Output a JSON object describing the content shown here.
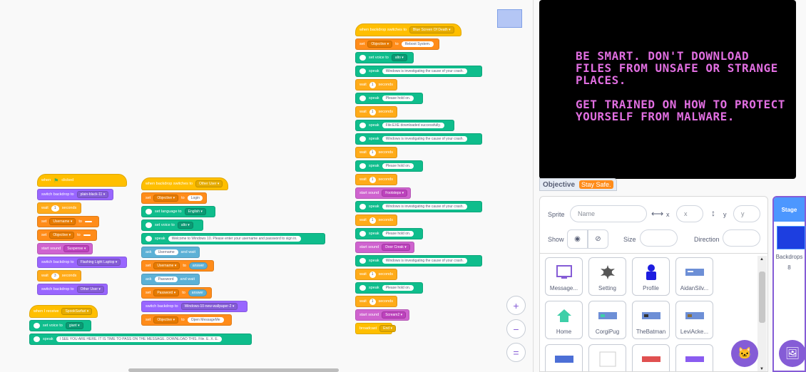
{
  "scripts": {
    "s1": {
      "hat": "when",
      "hat_suffix": "clicked",
      "b1": {
        "op": "switch backdrop to",
        "arg": "plain-black-11"
      },
      "b2": {
        "op": "wait",
        "arg": "1",
        "unit": "seconds"
      },
      "b3": {
        "op": "set",
        "arg": "Username",
        "to": "to",
        "val": ""
      },
      "b4": {
        "op": "set",
        "arg": "Objective",
        "to": "to",
        "val": ""
      },
      "b5": {
        "op": "start sound",
        "arg": "Suspense"
      },
      "b6": {
        "op": "switch backdrop to",
        "arg": "Flashing Light Laptop"
      },
      "b7": {
        "op": "wait",
        "arg": "3",
        "unit": "seconds"
      },
      "b8": {
        "op": "switch backdrop to",
        "arg": "Other User"
      }
    },
    "s2": {
      "hat": "when I receive",
      "hat_arg": "SpookSarfari",
      "b1": {
        "op": "set voice to",
        "arg": "giant"
      },
      "b2": {
        "op": "speak",
        "arg": "I SEE YOU ARE HERE. IT IS TIME TO PASS ON THE MESSAGE.  DOWNLOAD THIS.  File. E. X. E."
      }
    },
    "s3": {
      "hat": "when backdrop switches to",
      "hat_arg": "Other User",
      "b1": {
        "op": "set",
        "arg": "Objective",
        "to": "to",
        "val": "Login"
      },
      "b2": {
        "op": "set language to",
        "arg": "English"
      },
      "b3": {
        "op": "set voice to",
        "arg": "alto"
      },
      "b4": {
        "op": "speak",
        "arg": "Welcome to Windows 10. Please enter your username and password to sign in."
      },
      "b5": {
        "op": "ask",
        "arg": "Username",
        "suffix": "and wait"
      },
      "b6": {
        "op": "set",
        "arg": "Username",
        "to": "to",
        "val": "answer"
      },
      "b7": {
        "op": "ask",
        "arg": "Password",
        "suffix": "and wait"
      },
      "b8": {
        "op": "set",
        "arg": "Password",
        "to": "to",
        "val": "answer"
      },
      "b9": {
        "op": "switch backdrop to",
        "arg": "Windows-10-new-wallpaper-2"
      },
      "b10": {
        "op": "set",
        "arg": "Objective",
        "to": "to",
        "val": "Open MessageMe"
      }
    },
    "s4": {
      "hat": "when backdrop switches to",
      "hat_arg": "Blue Screen Of Death",
      "b1": {
        "op": "set",
        "arg": "Objective",
        "to": "to",
        "val": "Reboot System."
      },
      "b2": {
        "op": "set voice to",
        "arg": "alto"
      },
      "b3": {
        "op": "speak",
        "arg": "Windows is investigating the cause of your crash."
      },
      "b4": {
        "op": "wait",
        "arg": "1",
        "unit": "seconds"
      },
      "b5": {
        "op": "speak",
        "arg": "Please hold on."
      },
      "b6": {
        "op": "wait",
        "arg": "1",
        "unit": "seconds"
      },
      "b7": {
        "op": "speak",
        "arg": "File.EXE downloaded successfully."
      },
      "b8": {
        "op": "speak",
        "arg": "Windows is investigating the cause of your crash."
      },
      "b9": {
        "op": "wait",
        "arg": "1",
        "unit": "seconds"
      },
      "b10": {
        "op": "speak",
        "arg": "Please hold on."
      },
      "b11": {
        "op": "wait",
        "arg": "1",
        "unit": "seconds"
      },
      "b12": {
        "op": "start sound",
        "arg": "Footsteps"
      },
      "b13": {
        "op": "speak",
        "arg": "Windows is investigating the cause of your crash."
      },
      "b14": {
        "op": "wait",
        "arg": "1",
        "unit": "seconds"
      },
      "b15": {
        "op": "speak",
        "arg": "Please hold on."
      },
      "b16": {
        "op": "start sound",
        "arg": "Door Creak"
      },
      "b17": {
        "op": "speak",
        "arg": "Windows is investigating the cause of your crash."
      },
      "b18": {
        "op": "wait",
        "arg": "1",
        "unit": "seconds"
      },
      "b19": {
        "op": "speak",
        "arg": "Please hold on."
      },
      "b20": {
        "op": "wait",
        "arg": "1",
        "unit": "seconds"
      },
      "b21": {
        "op": "start sound",
        "arg": "Scream2"
      },
      "b22": {
        "op": "broadcast",
        "arg": "End"
      }
    }
  },
  "zoom": {
    "in": "+",
    "out": "−",
    "reset": "="
  },
  "stage": {
    "text": "BE SMART. DON'T DOWNLOAD\nFILES FROM UNSAFE OR STRANGE\nPLACES.\n\nGET TRAINED ON HOW TO PROTECT\nYOURSELF FROM MALWARE.",
    "text_color": "#e06ee0",
    "background": "#000000"
  },
  "monitor": {
    "label": "Objective",
    "value": "Stay Safe."
  },
  "sprite_info": {
    "sprite_label": "Sprite",
    "name_placeholder": "Name",
    "x_label": "x",
    "x_placeholder": "x",
    "y_label": "y",
    "y_placeholder": "y",
    "show_label": "Show",
    "size_label": "Size",
    "direction_label": "Direction"
  },
  "sprites": [
    {
      "name": "Message...",
      "icon": "monitor-icon"
    },
    {
      "name": "Setting",
      "icon": "gear-splat-icon"
    },
    {
      "name": "Profile",
      "icon": "person-icon"
    },
    {
      "name": "AidanSilv...",
      "icon": "screenshot-icon"
    },
    {
      "name": "Home",
      "icon": "house-icon"
    },
    {
      "name": "CorgiPug",
      "icon": "screenshot-icon"
    },
    {
      "name": "TheBatman",
      "icon": "screenshot-icon"
    },
    {
      "name": "LeviAcke...",
      "icon": "screenshot-icon"
    }
  ],
  "stage_panel": {
    "title": "Stage",
    "backdrops_label": "Backdrops",
    "backdrops_count": "8"
  },
  "colors": {
    "events": "#ffbf00",
    "data": "#ff8c1a",
    "looks": "#9966ff",
    "control": "#ffab19",
    "sound": "#cf63cf",
    "extension": "#0fbd8c",
    "accent": "#855cd6"
  }
}
